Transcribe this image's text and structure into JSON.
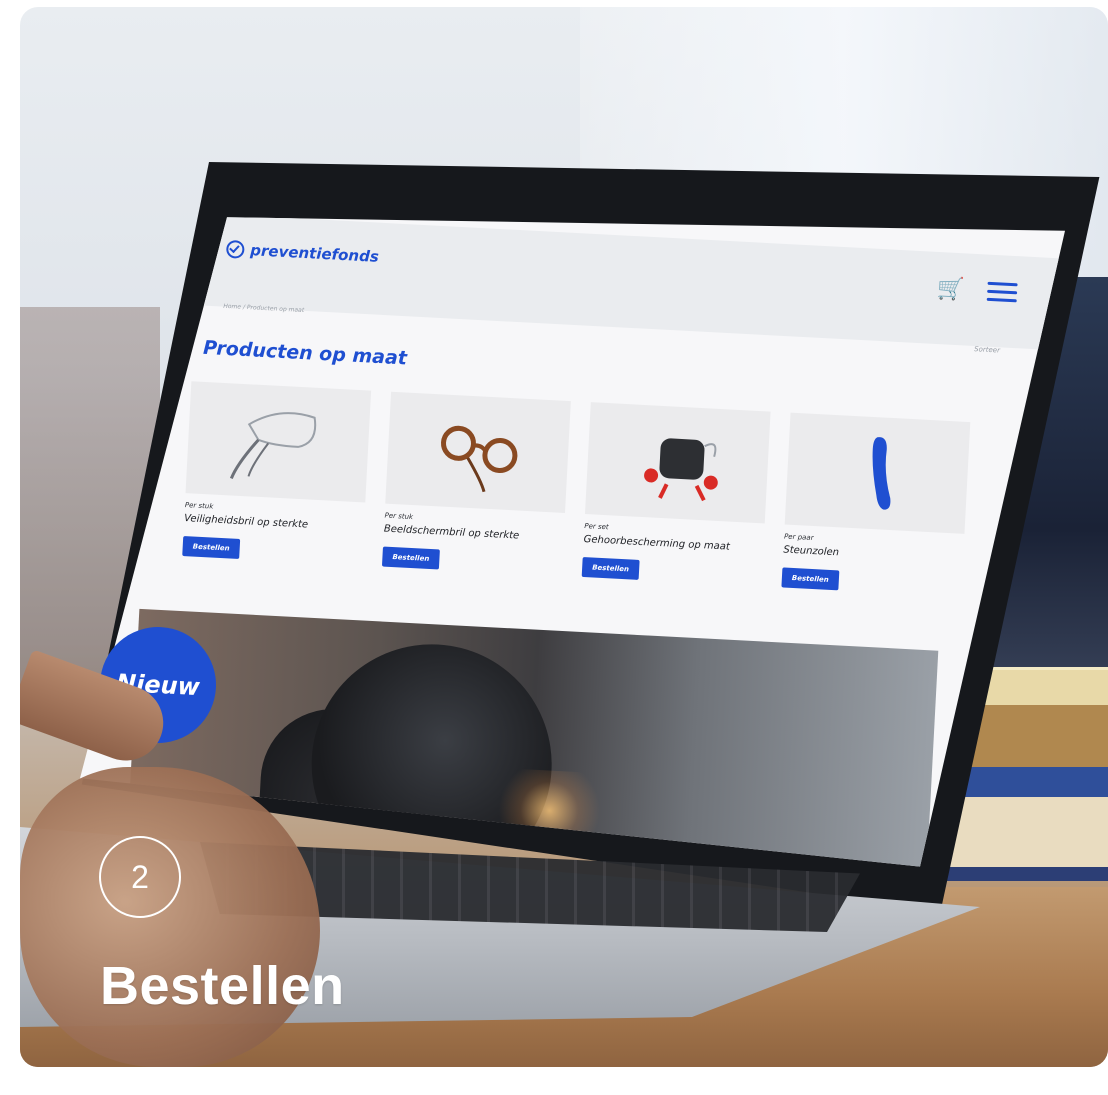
{
  "site": {
    "logo_text": "preventiefonds",
    "breadcrumb": "Home / Producten op maat",
    "sort_label": "Sorteer",
    "page_title": "Producten op maat"
  },
  "products": [
    {
      "unit": "Per stuk",
      "name": "Veiligheidsbril op sterkte",
      "button": "Bestellen"
    },
    {
      "unit": "Per stuk",
      "name": "Beeldschermbril op sterkte",
      "button": "Bestellen"
    },
    {
      "unit": "Per set",
      "name": "Gehoorbescherming op maat",
      "button": "Bestellen"
    },
    {
      "unit": "Per paar",
      "name": "Steunzolen",
      "button": "Bestellen"
    }
  ],
  "hero": {
    "badge": "Nieuw"
  },
  "overlay": {
    "step_number": "2",
    "step_title": "Bestellen"
  },
  "colors": {
    "brand_blue": "#1f4fd1",
    "white": "#ffffff"
  },
  "icons": [
    "check-shield-icon",
    "cart-icon",
    "menu-icon"
  ]
}
